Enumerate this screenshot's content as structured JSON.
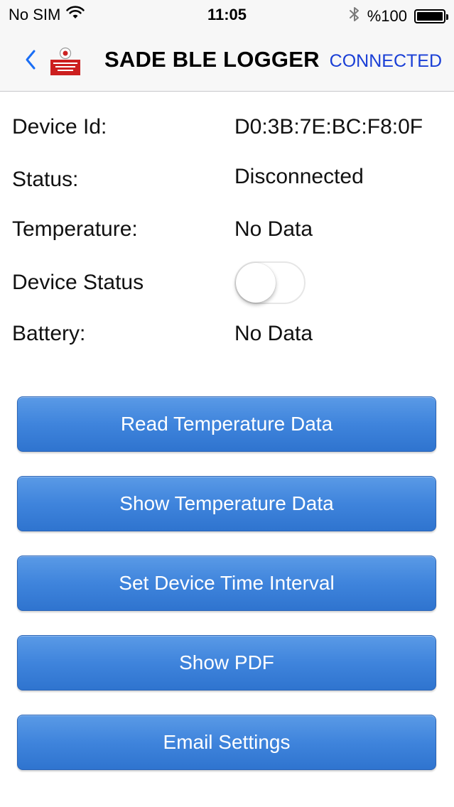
{
  "status_bar": {
    "carrier": "No SIM",
    "time": "11:05",
    "battery_text": "%100",
    "battery_level": 1.0
  },
  "nav": {
    "title": "SADE BLE LOGGER",
    "right_label": "CONNECTED",
    "right_color": "#1a3fd6"
  },
  "info": {
    "device_id_label": "Device Id:",
    "device_id_value": "D0:3B:7E:BC:F8:0F",
    "status_label": "Status:",
    "status_value": "Disconnected",
    "temperature_label": "Temperature:",
    "temperature_value": "No Data",
    "device_status_label": "Device Status",
    "device_status_on": false,
    "battery_label": "Battery:",
    "battery_value": "No Data"
  },
  "buttons": {
    "read_temperature": "Read Temperature Data",
    "show_temperature": "Show Temperature Data",
    "set_interval": "Set Device Time Interval",
    "show_pdf": "Show PDF",
    "email_settings": "Email Settings"
  },
  "colors": {
    "button_blue": "#3f84dc",
    "header_bg": "#f7f7f7",
    "link_blue": "#1a3fd6"
  }
}
